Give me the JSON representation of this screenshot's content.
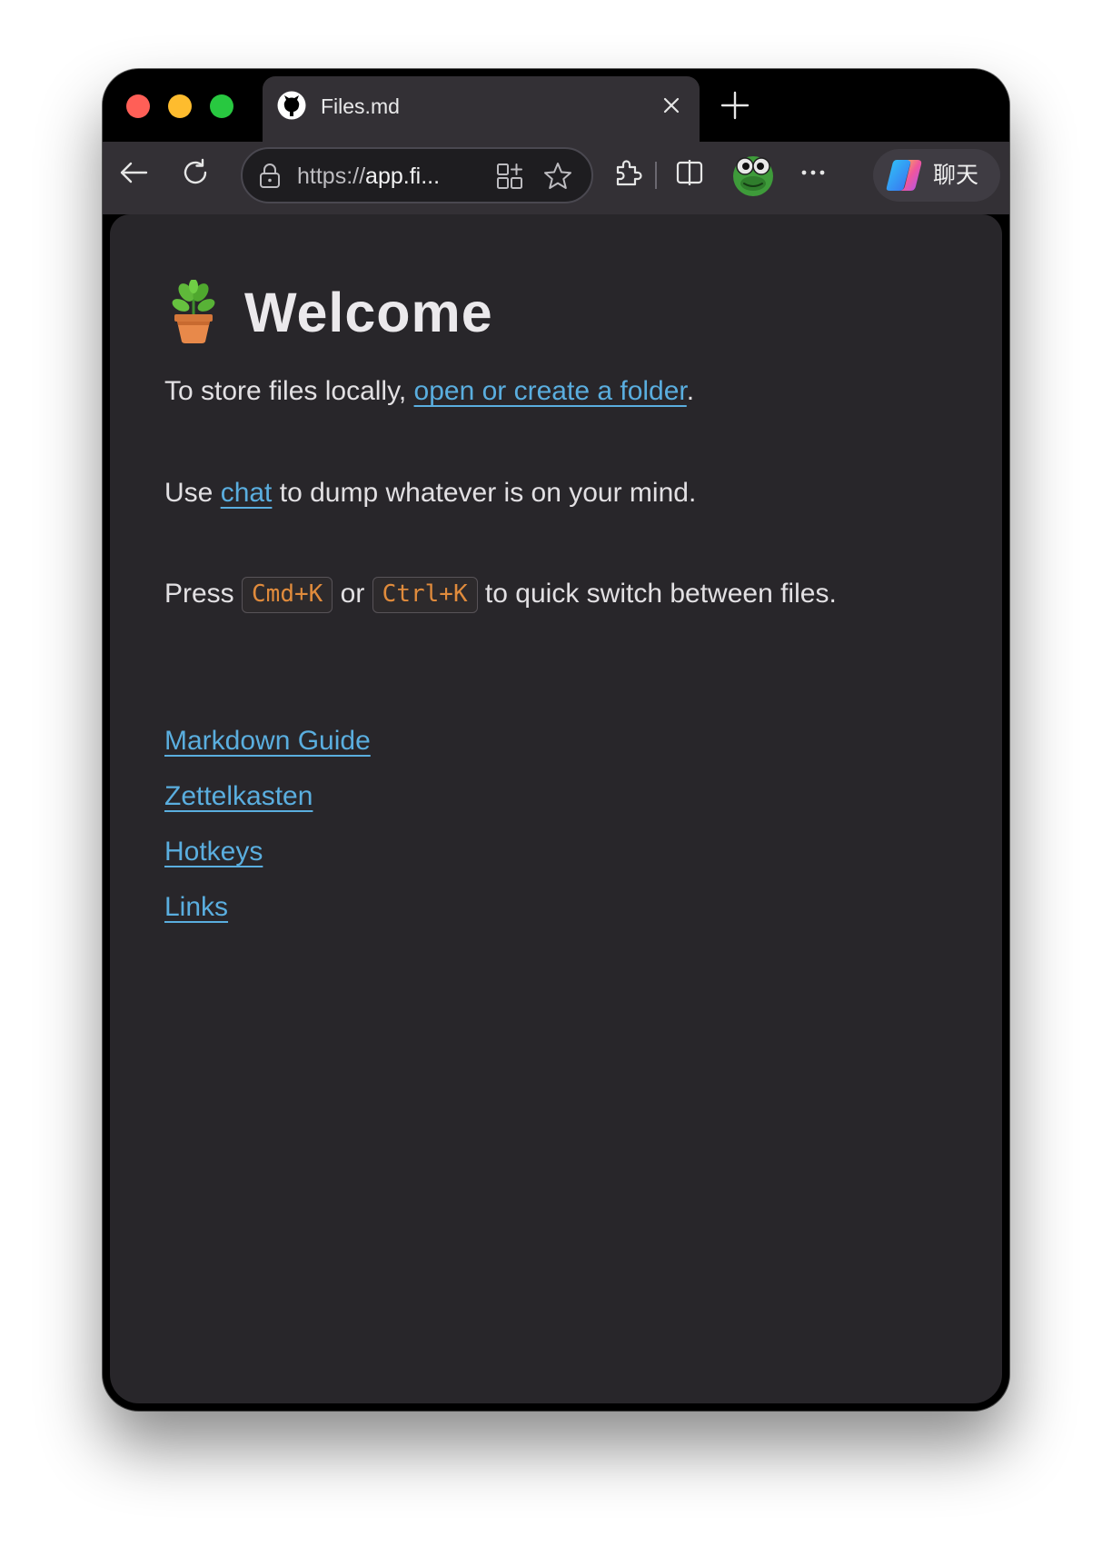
{
  "browser": {
    "tab": {
      "title": "Files.md",
      "icon": "octocat-icon"
    },
    "url": {
      "scheme": "https://",
      "host": "app.fi..."
    },
    "copilot_label": "聊天"
  },
  "page": {
    "heading": "Welcome",
    "heading_icon": "potted-plant-emoji",
    "para1": {
      "before": "To store files locally, ",
      "link": "open or create a folder",
      "after": "."
    },
    "para2": {
      "before": "Use ",
      "link": "chat",
      "after": " to dump whatever is on your mind."
    },
    "para3": {
      "before": "Press ",
      "key1": "Cmd+K",
      "middle": " or ",
      "key2": "Ctrl+K",
      "after": " to quick switch between files."
    },
    "links": [
      {
        "label": "Markdown Guide"
      },
      {
        "label": "Zettelkasten"
      },
      {
        "label": "Hotkeys"
      },
      {
        "label": "Links"
      }
    ]
  },
  "colors": {
    "link": "#5aaedf",
    "code": "#e08b3c",
    "background": "#28262a"
  }
}
